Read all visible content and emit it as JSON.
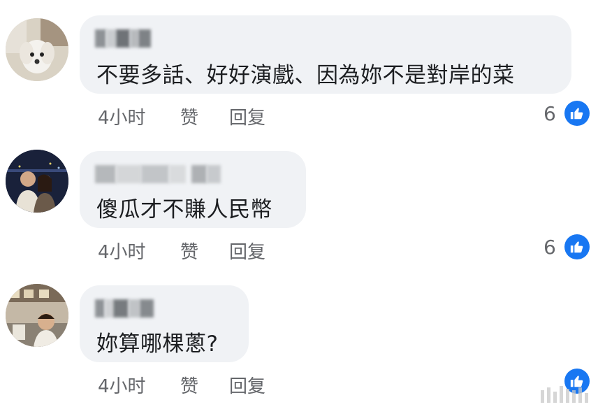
{
  "comments": [
    {
      "text": "不要多話、好好演戲、因為妳不是對岸的菜",
      "time": "4小时",
      "like_label": "赞",
      "reply_label": "回复",
      "like_count": "6",
      "avatar_icon": "dog-avatar"
    },
    {
      "text": "傻瓜才不賺人民幣",
      "time": "4小时",
      "like_label": "赞",
      "reply_label": "回复",
      "like_count": "6",
      "avatar_icon": "couple-avatar"
    },
    {
      "text": "妳算哪棵蔥?",
      "time": "4小时",
      "like_label": "赞",
      "reply_label": "回复",
      "like_count": "",
      "avatar_icon": "person-avatar"
    }
  ],
  "colors": {
    "bubble": "#f0f2f5",
    "like_blue": "#1877f2",
    "meta_gray": "#65676b",
    "text": "#1c1e21"
  }
}
